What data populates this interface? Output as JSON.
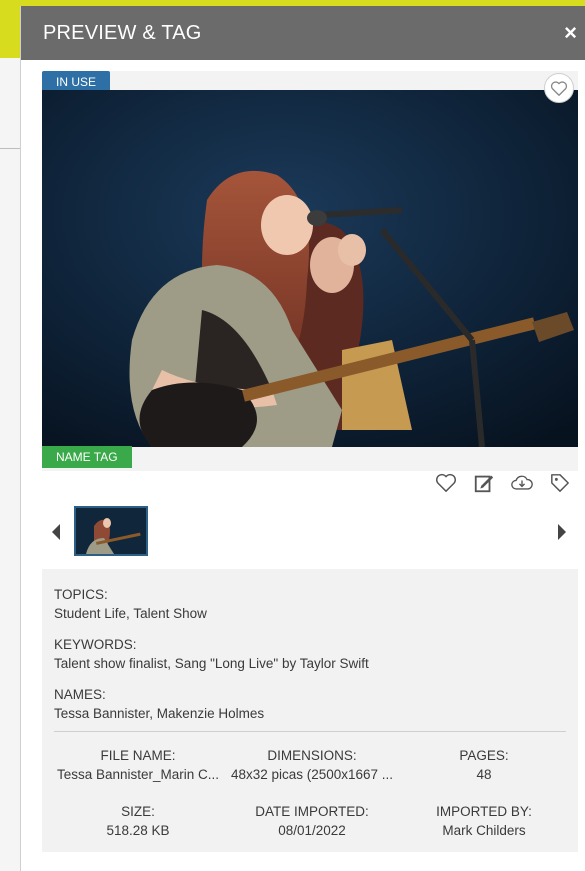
{
  "panel": {
    "title": "PREVIEW & TAG",
    "close_label": "×"
  },
  "badges": {
    "in_use": "IN USE",
    "name_tag": "NAME TAG"
  },
  "icons": {
    "favorite_top": "heart-outline-icon",
    "favorite": "heart-outline-icon",
    "edit": "edit-note-icon",
    "download": "cloud-download-icon",
    "tag": "tag-icon",
    "prev": "triangle-left-icon",
    "next": "triangle-right-icon",
    "close": "close-icon"
  },
  "info": {
    "topics_label": "TOPICS:",
    "topics_value": "Student Life, Talent Show",
    "keywords_label": "KEYWORDS:",
    "keywords_value": "Talent show finalist, Sang \"Long Live\" by Taylor Swift",
    "names_label": "NAMES:",
    "names_value": "Tessa Bannister, Makenzie Holmes"
  },
  "meta": {
    "file_name_label": "FILE NAME:",
    "file_name_value": "Tessa Bannister_Marin C...",
    "dimensions_label": "DIMENSIONS:",
    "dimensions_value": "48x32 picas (2500x1667 ...",
    "pages_label": "PAGES:",
    "pages_value": "48",
    "size_label": "SIZE:",
    "size_value": "518.28 KB",
    "date_label": "DATE IMPORTED:",
    "date_value": "08/01/2022",
    "imported_by_label": "IMPORTED BY:",
    "imported_by_value": "Mark Childers"
  },
  "colors": {
    "header": "#6b6b6b",
    "in_use_badge": "#2e6fa6",
    "name_tag_badge": "#3aa94a",
    "accent_yellow": "#d7dc1e"
  }
}
